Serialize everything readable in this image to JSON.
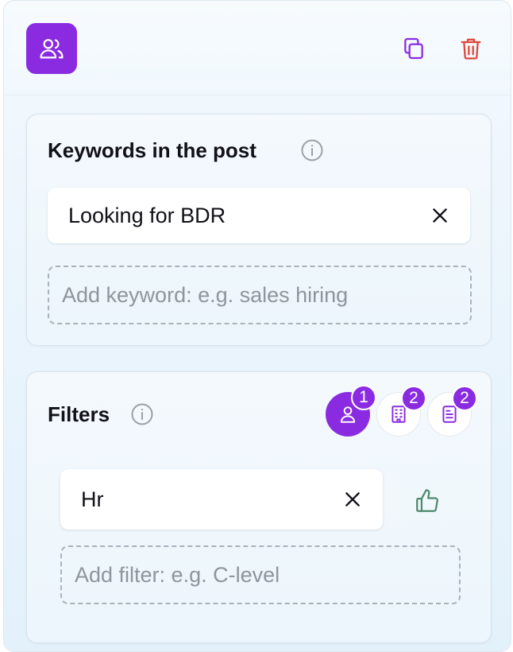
{
  "header": {
    "group_icon": "users-icon",
    "copy_icon": "copy-icon",
    "delete_icon": "trash-icon"
  },
  "keywords_section": {
    "title": "Keywords in the post",
    "info_icon": "info-icon",
    "keywords": [
      {
        "text": "Looking for BDR",
        "remove_icon": "close-icon"
      }
    ],
    "add_placeholder": "Add keyword: e.g. sales hiring"
  },
  "filters_section": {
    "title": "Filters",
    "info_icon": "info-icon",
    "tabs": [
      {
        "icon": "person-icon",
        "count": "1",
        "active": true
      },
      {
        "icon": "building-icon",
        "count": "2",
        "active": false
      },
      {
        "icon": "document-icon",
        "count": "2",
        "active": false
      }
    ],
    "filters": [
      {
        "text": "Hr",
        "remove_icon": "close-icon",
        "sentiment_icon": "thumbs-up-icon"
      }
    ],
    "add_placeholder": "Add filter: e.g. C-level"
  },
  "colors": {
    "accent": "#8a2be2",
    "delete": "#e0453b",
    "thumbs_up": "#4f8a6d",
    "info": "#9aa0a6"
  }
}
